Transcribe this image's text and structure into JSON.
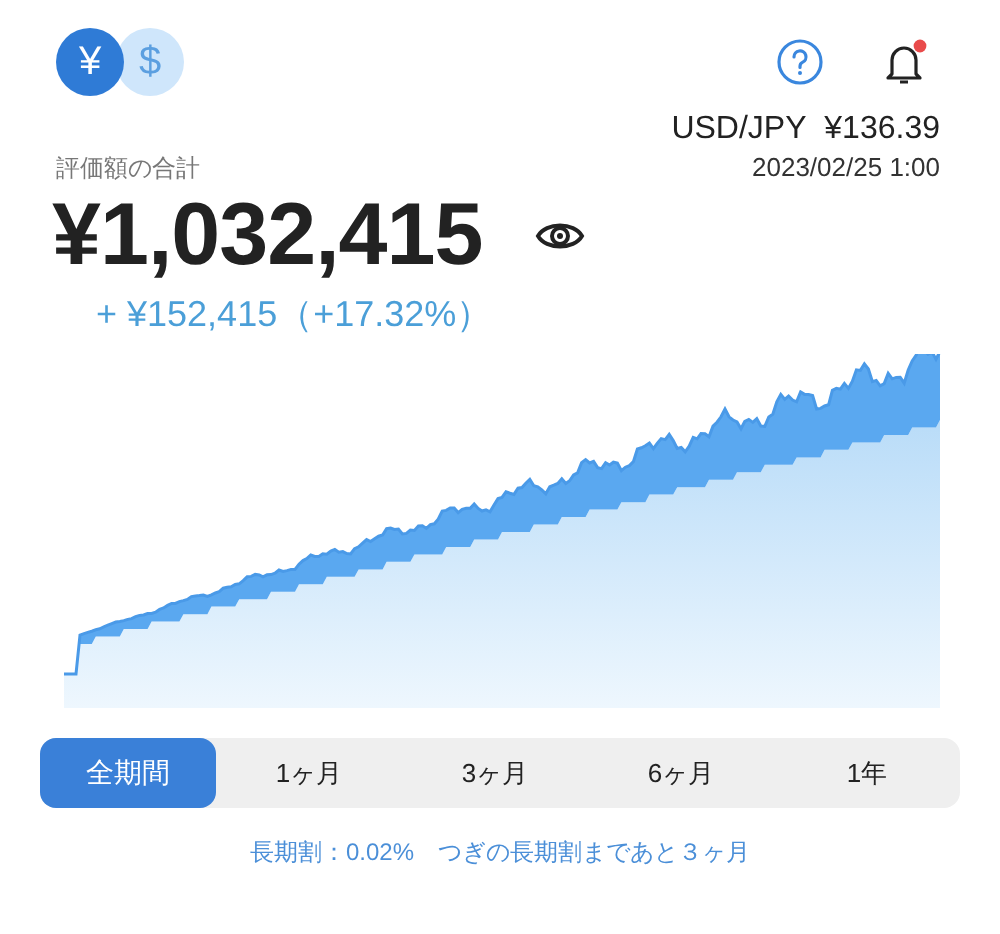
{
  "currency_toggle": [
    {
      "symbol": "¥",
      "selected": true
    },
    {
      "symbol": "$",
      "selected": false
    }
  ],
  "notifications": {
    "unread": true
  },
  "exchange_rate": {
    "pair": "USD/JPY",
    "rate": "¥136.39",
    "timestamp": "2023/02/25 1:00"
  },
  "total": {
    "label": "評価額の合計",
    "value": "¥1,032,415",
    "change": "+ ¥152,415（+17.32%）"
  },
  "period_tabs": [
    {
      "label": "全期間",
      "selected": true
    },
    {
      "label": "1ヶ月",
      "selected": false
    },
    {
      "label": "3ヶ月",
      "selected": false
    },
    {
      "label": "6ヶ月",
      "selected": false
    },
    {
      "label": "1年",
      "selected": false
    }
  ],
  "footer_note": "長期割：0.02%　つぎの長期割まであと３ヶ月"
}
